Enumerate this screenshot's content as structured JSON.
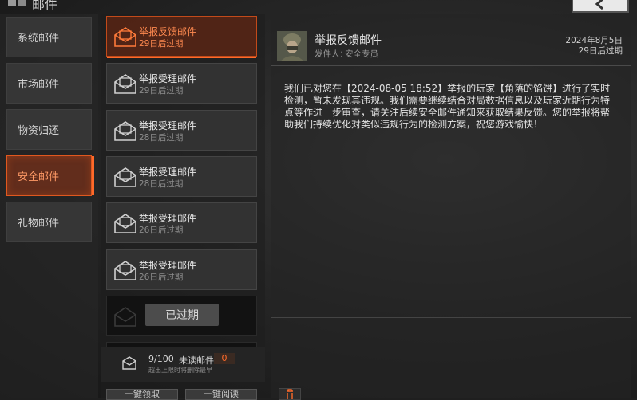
{
  "header": {
    "title": "邮件"
  },
  "categories": [
    {
      "label": "系统邮件",
      "active": false
    },
    {
      "label": "市场邮件",
      "active": false
    },
    {
      "label": "物资归还",
      "active": false
    },
    {
      "label": "安全邮件",
      "active": true
    },
    {
      "label": "礼物邮件",
      "active": false
    }
  ],
  "mails": [
    {
      "title": "举报反馈邮件",
      "sub": "29日后过期",
      "active": true
    },
    {
      "title": "举报受理邮件",
      "sub": "29日后过期",
      "active": false
    },
    {
      "title": "举报受理邮件",
      "sub": "28日后过期",
      "active": false
    },
    {
      "title": "举报受理邮件",
      "sub": "28日后过期",
      "active": false
    },
    {
      "title": "举报受理邮件",
      "sub": "26日后过期",
      "active": false
    },
    {
      "title": "举报受理邮件",
      "sub": "26日后过期",
      "active": false
    }
  ],
  "expired_label": "已过期",
  "list_footer": {
    "count": "9/100",
    "unread_label": "未读邮件",
    "unread_count": "0",
    "limit_note": "超出上限时将删除最早"
  },
  "bottom_buttons": {
    "left": "一键领取",
    "right": "一键阅读"
  },
  "detail": {
    "title": "举报反馈邮件",
    "sender_label": "发件人：",
    "sender": "安全专员",
    "date": "2024年8月5日",
    "expires": "29日后过期",
    "body": "我们已对您在【2024-08-05 18:52】举报的玩家【角落的馅饼】进行了实时检测，暂未发现其违规。我们需要继续结合对局数据信息以及玩家近期行为特点等作进一步审查，请关注后续安全邮件通知来获取结果反馈。您的举报将帮助我们持续优化对类似违规行为的检测方案，祝您游戏愉快！"
  },
  "colors": {
    "accent": "#ff6a2a",
    "active_bg": "#7a2a10"
  }
}
